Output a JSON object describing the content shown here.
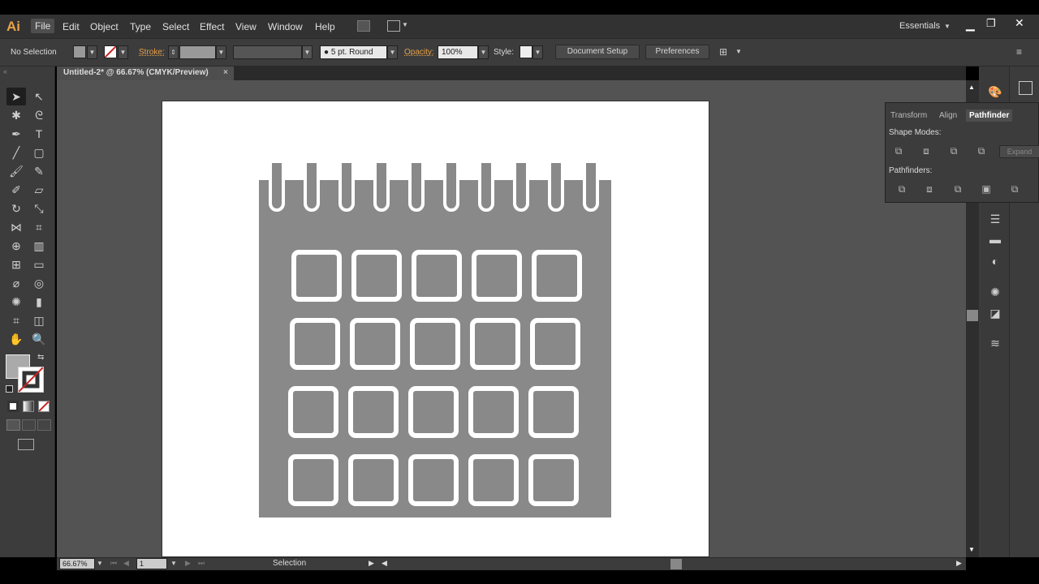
{
  "app": {
    "logo": "Ai"
  },
  "menu": {
    "items": [
      "File",
      "Edit",
      "Object",
      "Type",
      "Select",
      "Effect",
      "View",
      "Window",
      "Help"
    ]
  },
  "workspace": {
    "label": "Essentials"
  },
  "control": {
    "selection_status": "No Selection",
    "stroke_label": "Stroke:",
    "brush_value": "5 pt. Round",
    "opacity_label": "Opacity:",
    "opacity_value": "100%",
    "style_label": "Style:",
    "doc_setup": "Document Setup",
    "preferences": "Preferences"
  },
  "document": {
    "tab_title": "Untitled-2* @ 66.67% (CMYK/Preview)"
  },
  "status": {
    "zoom": "66.67%",
    "artboard_num": "1",
    "tool_status": "Selection"
  },
  "pathfinder_panel": {
    "tabs": [
      "Transform",
      "Align",
      "Pathfinder"
    ],
    "shape_modes": "Shape Modes:",
    "expand": "Expand",
    "pathfinders": "Pathfinders:"
  },
  "colors": {
    "accent": "#e8a24a",
    "artwork": "#898989",
    "stroke_none": "#cc2222"
  }
}
